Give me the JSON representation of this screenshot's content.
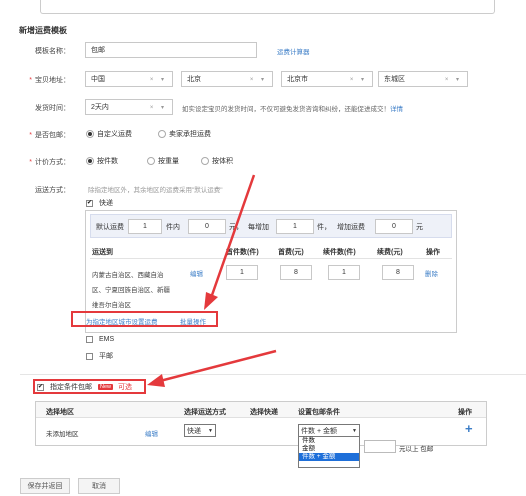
{
  "heading": "新增运费模板",
  "form": {
    "name_label": "模板名称：",
    "name_value": "包邮",
    "calc_link": "运费计算器",
    "addr_label": "宝贝地址：",
    "addr": [
      "中国",
      "北京",
      "北京市",
      "东城区"
    ],
    "ship_label": "发货时间：",
    "ship_value": "2天内",
    "ship_note": "如实设定宝贝的发货时间，不仅可避免发货咨询和纠纷，还能促进成交！",
    "ship_detail": "详情",
    "free_label": "是否包邮：",
    "free_opt1": "自定义运费",
    "free_opt2": "卖家承担运费",
    "price_label": "计价方式：",
    "price_opt1": "按件数",
    "price_opt2": "按重量",
    "price_opt3": "按体积",
    "way_label": "运送方式：",
    "way_note": "除指定地区外，其余地区的运费采用\"默认运费\"",
    "express_label": "快递"
  },
  "default_fee": {
    "label": "默认运费",
    "qty": "1",
    "unit1": "件内",
    "fee": "0",
    "unit2": "元，",
    "add_label": "每增加",
    "add_qty": "1",
    "unit3": "件，",
    "add_fee_label": "增加运费",
    "add_fee": "0",
    "unit4": "元"
  },
  "region_table": {
    "headers": [
      "运送到",
      "首件数(件)",
      "首费(元)",
      "续件数(件)",
      "续费(元)",
      "操作"
    ],
    "row": {
      "regions": [
        "内蒙古自治区、西藏自治",
        "区、宁夏回族自治区、新疆",
        "维吾尔自治区"
      ],
      "edit": "编辑",
      "first_qty": "1",
      "first_fee": "8",
      "add_qty": "1",
      "add_fee": "8",
      "op": "删除"
    },
    "set_link": "为指定地区城市设置运费",
    "batch_link": "批量操作"
  },
  "other_ways": [
    "EMS",
    "平邮"
  ],
  "conditional": {
    "label": "指定条件包邮",
    "badge": "New",
    "optional": "可选"
  },
  "cond_table": {
    "headers": [
      "选择地区",
      "选择运送方式",
      "选择快递",
      "设置包邮条件",
      "操作"
    ],
    "row": {
      "area": "未添加地区",
      "edit": "编辑",
      "way": "快递",
      "cond": "件数 + 金额",
      "suffix": "元以上 包邮",
      "add": "+"
    },
    "dropdown": [
      "件数",
      "金额",
      "件数 + 金额"
    ]
  },
  "buttons": {
    "save": "保存并返回",
    "cancel": "取消"
  },
  "colors": {
    "annotation": "#e4393c",
    "link": "#3c7ec7",
    "highlight": "#1e6fd9"
  }
}
